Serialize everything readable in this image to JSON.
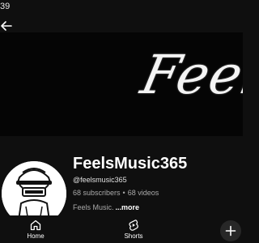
{
  "status_bar": {
    "time": "39"
  },
  "banner": {
    "text": "Feels"
  },
  "channel": {
    "name": "FeelsMusic365",
    "handle": "@feelsmusic365",
    "subscribers": "68 subscribers",
    "separator": "•",
    "videos": "68 videos",
    "description": "Feels Music.",
    "more_label": "...more"
  },
  "bottom_nav": {
    "items": [
      {
        "label": "Home",
        "icon": "home-icon"
      },
      {
        "label": "Shorts",
        "icon": "shorts-icon"
      }
    ],
    "create_icon": "plus-icon"
  },
  "icons": {
    "back": "arrow-left-icon"
  },
  "colors": {
    "background": "#0f0f0f",
    "secondary_text": "#aaaaaa",
    "create_button": "#272727"
  }
}
